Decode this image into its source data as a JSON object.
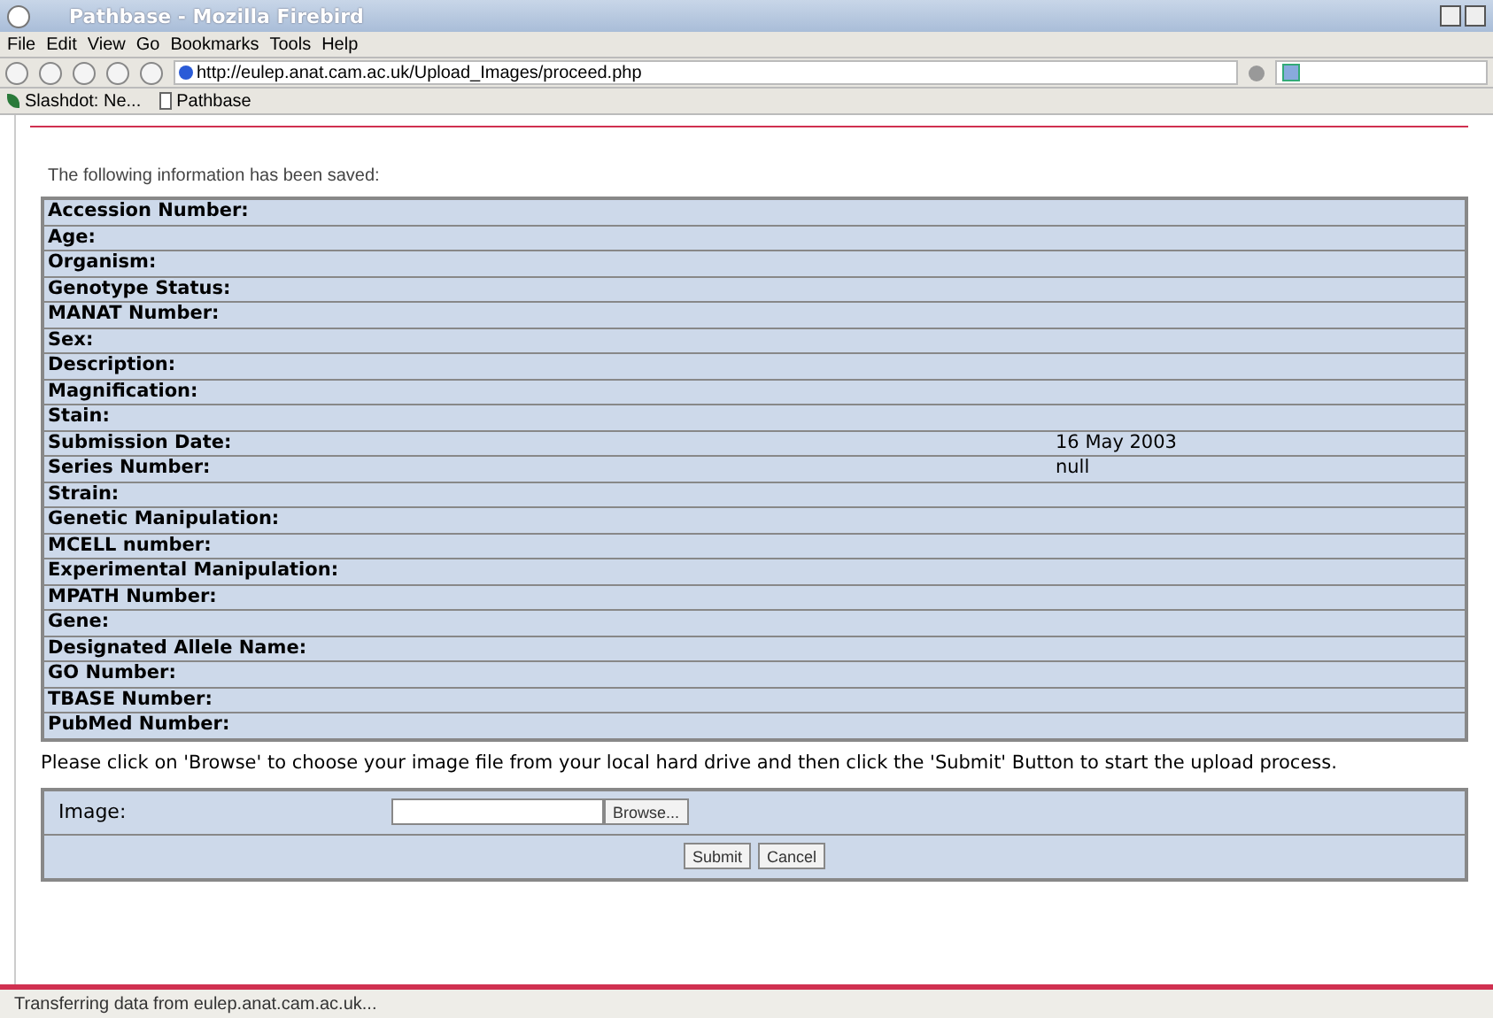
{
  "window": {
    "title": "Pathbase - Mozilla Firebird"
  },
  "menu": [
    "File",
    "Edit",
    "View",
    "Go",
    "Bookmarks",
    "Tools",
    "Help"
  ],
  "address": {
    "value": "http://eulep.anat.cam.ac.uk/Upload_Images/proceed.php"
  },
  "bookmarks": [
    "Slashdot: Ne...",
    "Pathbase"
  ],
  "intro": "The following information has been saved:",
  "table": {
    "rows": [
      {
        "label": "Accession Number:"
      },
      {
        "label": "Age:"
      },
      {
        "label": "Organism:"
      },
      {
        "label": "Genotype Status:"
      },
      {
        "label": "MANAT Number:"
      },
      {
        "label": "Sex:"
      },
      {
        "label": "Description:"
      },
      {
        "label": "Magnification:"
      },
      {
        "label": "Stain:"
      },
      {
        "label": "Submission Date:",
        "value": "16 May 2003"
      },
      {
        "label": "Series Number:",
        "value": "null"
      },
      {
        "label": "Strain:"
      },
      {
        "label": "Genetic Manipulation:"
      },
      {
        "label": "MCELL number:"
      },
      {
        "label": "Experimental Manipulation:"
      },
      {
        "label": "MPATH Number:"
      },
      {
        "label": "Gene:"
      },
      {
        "label": "Designated Allele Name:"
      },
      {
        "label": "GO Number:"
      },
      {
        "label": "TBASE Number:"
      },
      {
        "label": "PubMed Number:"
      }
    ]
  },
  "instructions": "Please click on 'Browse' to choose your image file from your local hard drive and then click the 'Submit' Button to start the upload process.",
  "upload": {
    "label": "Image:",
    "browse": "Browse...",
    "buttons": [
      "Submit",
      "Cancel"
    ]
  },
  "status_bar": "Transferring data from eulep.anat.cam.ac.uk..."
}
